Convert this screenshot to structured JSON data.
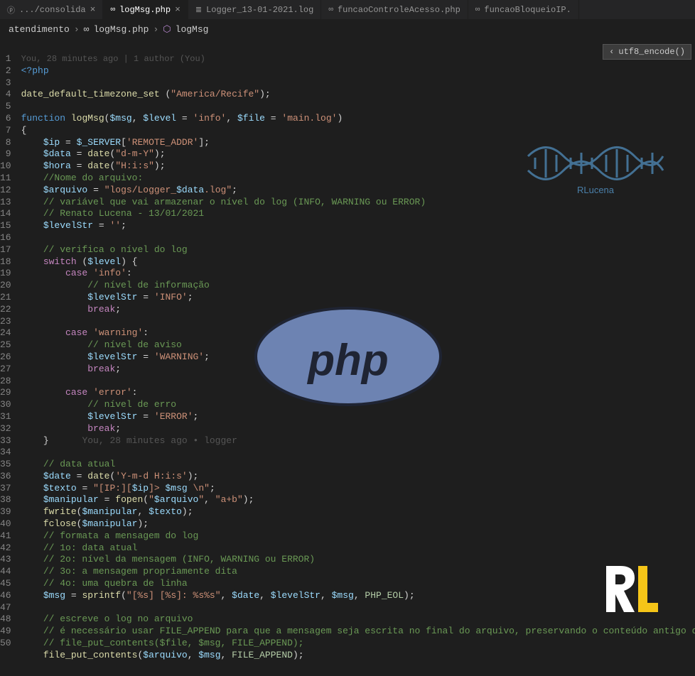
{
  "tabs": [
    {
      "icon": "ⓟ",
      "label": ".../consolida",
      "close": true,
      "active": false
    },
    {
      "icon": "∞",
      "label": "logMsg.php",
      "close": true,
      "active": true
    },
    {
      "icon": "≣",
      "label": "Logger_13-01-2021.log",
      "close": false,
      "active": false
    },
    {
      "icon": "∞",
      "label": "funcaoControleAcesso.php",
      "close": false,
      "active": false
    },
    {
      "icon": "∞",
      "label": "funcaoBloqueioIP.",
      "close": false,
      "active": false
    }
  ],
  "breadcrumb": {
    "p0": "atendimento",
    "icon1": "∞",
    "p1": "logMsg.php",
    "icon2": "⬡",
    "p2": "logMsg"
  },
  "overlay": {
    "chevron": "‹",
    "label": "utf8_encode()"
  },
  "blame_top": "You, 28 minutes ago | 1 author (You)",
  "inline_blame": "You, 28 minutes ago • logger",
  "code": {
    "l1_open": "<?php",
    "l3_fn": "date_default_timezone_set",
    "l3_arg": "\"America/Recife\"",
    "l5_kw": "function",
    "l5_name": "logMsg",
    "l5_p1": "$msg",
    "l5_p2": "$level",
    "l5_d2": "'info'",
    "l5_p3": "$file",
    "l5_d3": "'main.log'",
    "l7_v1": "$ip",
    "l7_v2": "$_SERVER",
    "l7_k": "'REMOTE_ADDR'",
    "l8_v": "$data",
    "l8_fn": "date",
    "l8_s": "\"d-m-Y\"",
    "l9_v": "$hora",
    "l9_fn": "date",
    "l9_s": "\"H:i:s\"",
    "l10_c": "//Nome do arquivo:",
    "l11_v": "$arquivo",
    "l11_s1": "\"logs/Logger_",
    "l11_v2": "$data",
    "l11_s2": ".log\"",
    "l12_c": "// variável que vai armazenar o nível do log (INFO, WARNING ou ERROR)",
    "l13_c": "// Renato Lucena - 13/01/2021",
    "l14_v": "$levelStr",
    "l14_s": "''",
    "l16_c": "// verifica o nível do log",
    "l17_kw": "switch",
    "l17_v": "$level",
    "l18_kw": "case",
    "l18_s": "'info'",
    "l19_c": "// nível de informação",
    "l20_v": "$levelStr",
    "l20_s": "'INFO'",
    "l21_kw": "break",
    "l23_kw": "case",
    "l23_s": "'warning'",
    "l24_c": "// nível de aviso",
    "l25_v": "$levelStr",
    "l25_s": "'WARNING'",
    "l26_kw": "break",
    "l28_kw": "case",
    "l28_s": "'error'",
    "l29_c": "// nível de erro",
    "l30_v": "$levelStr",
    "l30_s": "'ERROR'",
    "l31_kw": "break",
    "l34_c": "// data atual",
    "l35_v": "$date",
    "l35_fn": "date",
    "l35_s": "'Y-m-d H:i:s'",
    "l36_v": "$texto",
    "l36_s1": "\"[IP:][",
    "l36_v2": "$ip",
    "l36_s2": "]> ",
    "l36_v3": "$msg",
    "l36_s3": " \\n\"",
    "l37_v": "$manipular",
    "l37_fn": "fopen",
    "l37_s1": "\"",
    "l37_v2": "$arquivo",
    "l37_s2": "\"",
    "l37_s3": "\"a+b\"",
    "l38_fn": "fwrite",
    "l38_v1": "$manipular",
    "l38_v2": "$texto",
    "l39_fn": "fclose",
    "l39_v": "$manipular",
    "l40_c": "// formata a mensagem do log",
    "l41_c": "// 1o: data atual",
    "l42_c": "// 2o: nível da mensagem (INFO, WARNING ou ERROR)",
    "l43_c": "// 3o: a mensagem propriamente dita",
    "l44_c": "// 4o: uma quebra de linha",
    "l45_v": "$msg",
    "l45_fn": "sprintf",
    "l45_s": "\"[%s] [%s]: %s%s\"",
    "l45_v2": "$date",
    "l45_v3": "$levelStr",
    "l45_v4": "$msg",
    "l45_c": "PHP_EOL",
    "l47_c": "// escreve o log no arquivo",
    "l48_c": "// é necessário usar FILE_APPEND para que a mensagem seja escrita no final do arquivo, preservando o conteúdo antigo do ar",
    "l49_c": "// file_put_contents($file, $msg, FILE_APPEND);",
    "l50_fn": "file_put_contents",
    "l50_v1": "$arquivo",
    "l50_v2": "$msg",
    "l50_c": "FILE_APPEND"
  },
  "logos": {
    "dna_text": "RLucena"
  }
}
